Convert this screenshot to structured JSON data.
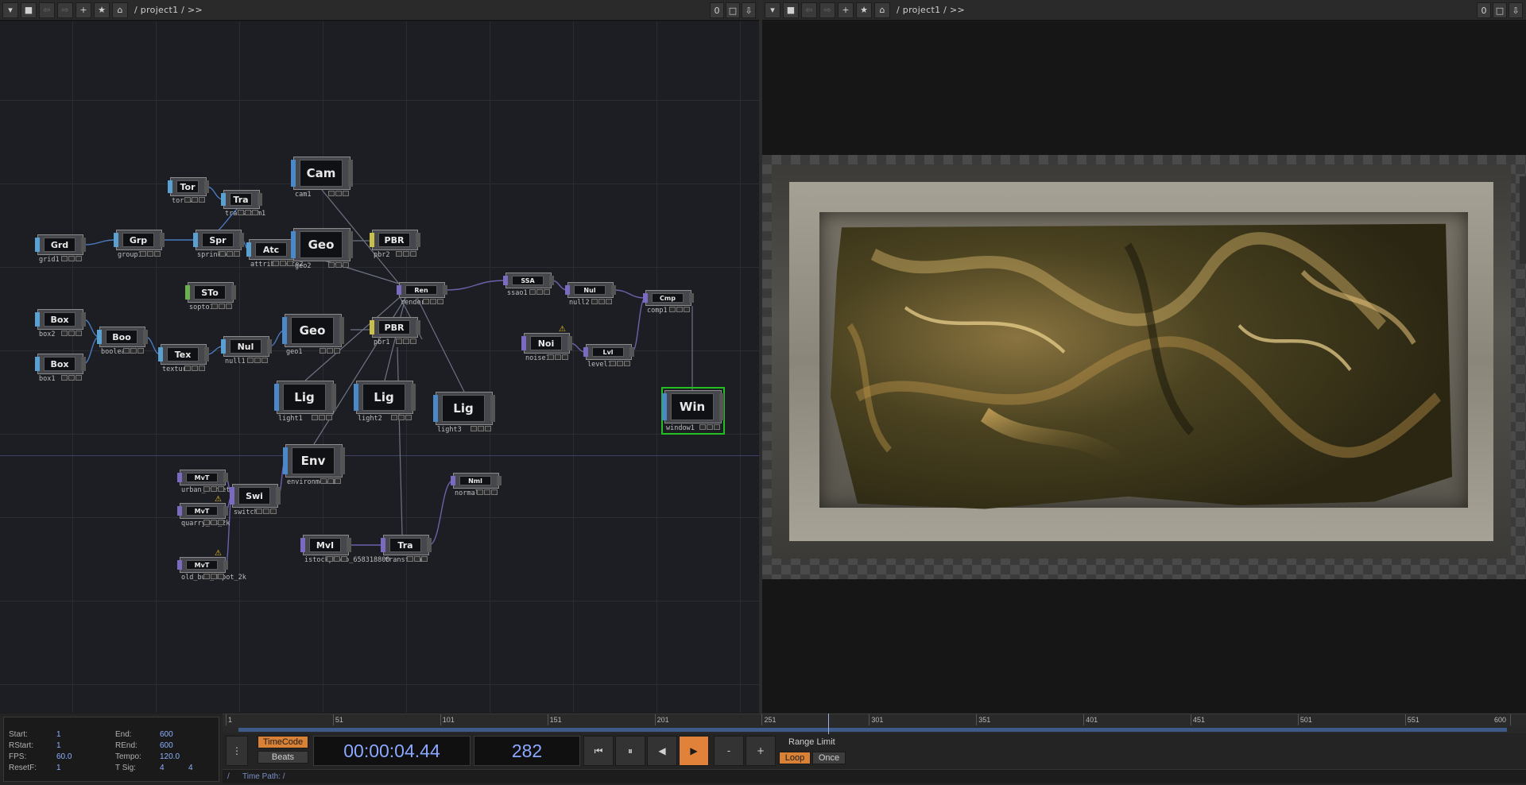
{
  "left_pane": {
    "path": "/ project1 / >>",
    "counter": "0"
  },
  "right_pane": {
    "path": "/ project1 / >>",
    "counter": "0"
  },
  "nodes": [
    {
      "id": "tor",
      "label": "Tor",
      "name": "torus1",
      "family": "sop"
    },
    {
      "id": "tra1",
      "label": "Tra",
      "name": "transform1",
      "family": "sop"
    },
    {
      "id": "cam",
      "label": "Cam",
      "name": "cam1",
      "family": "comp"
    },
    {
      "id": "grd",
      "label": "Grd",
      "name": "grid1",
      "family": "sop"
    },
    {
      "id": "grp",
      "label": "Grp",
      "name": "group1",
      "family": "sop"
    },
    {
      "id": "spr",
      "label": "Spr",
      "name": "sprinkle1",
      "family": "sop"
    },
    {
      "id": "atc",
      "label": "Atc",
      "name": "attribcreate2",
      "family": "sop"
    },
    {
      "id": "geo2",
      "label": "Geo",
      "name": "geo2",
      "family": "comp"
    },
    {
      "id": "pbr2",
      "label": "PBR",
      "name": "pbr2",
      "family": "mat"
    },
    {
      "id": "sto",
      "label": "STo",
      "name": "sopto1",
      "family": "sto"
    },
    {
      "id": "ren",
      "label": "Ren",
      "name": "render1",
      "family": "top"
    },
    {
      "id": "ssa",
      "label": "SSA",
      "name": "ssao1",
      "family": "top"
    },
    {
      "id": "nul2",
      "label": "Nul",
      "name": "null2",
      "family": "top"
    },
    {
      "id": "cmp",
      "label": "Cmp",
      "name": "comp1",
      "family": "top"
    },
    {
      "id": "box2",
      "label": "Box",
      "name": "box2",
      "family": "sop"
    },
    {
      "id": "boo",
      "label": "Boo",
      "name": "boolean3",
      "family": "sop"
    },
    {
      "id": "box1",
      "label": "Box",
      "name": "box1",
      "family": "sop"
    },
    {
      "id": "tex",
      "label": "Tex",
      "name": "texture1",
      "family": "sop"
    },
    {
      "id": "nul1",
      "label": "Nul",
      "name": "null1",
      "family": "sop"
    },
    {
      "id": "geo1",
      "label": "Geo",
      "name": "geo1",
      "family": "comp"
    },
    {
      "id": "pbr1",
      "label": "PBR",
      "name": "pbr1",
      "family": "mat"
    },
    {
      "id": "noi",
      "label": "Noi",
      "name": "noise1",
      "family": "top"
    },
    {
      "id": "lvl",
      "label": "Lvl",
      "name": "level1",
      "family": "top"
    },
    {
      "id": "lig1",
      "label": "Lig",
      "name": "light1",
      "family": "comp"
    },
    {
      "id": "lig2",
      "label": "Lig",
      "name": "light2",
      "family": "comp"
    },
    {
      "id": "lig3",
      "label": "Lig",
      "name": "light3",
      "family": "comp"
    },
    {
      "id": "win",
      "label": "Win",
      "name": "window1",
      "family": "comp"
    },
    {
      "id": "env",
      "label": "Env",
      "name": "environment1",
      "family": "comp"
    },
    {
      "id": "mvt1",
      "label": "MvT",
      "name": "urban_street",
      "family": "top"
    },
    {
      "id": "mvt2",
      "label": "MvT",
      "name": "quarry_03_2k",
      "family": "top"
    },
    {
      "id": "swi",
      "label": "Swi",
      "name": "switch1",
      "family": "top"
    },
    {
      "id": "nml",
      "label": "Nml",
      "name": "normal1",
      "family": "top"
    },
    {
      "id": "mvt3",
      "label": "MvT",
      "name": "old_bus_depot_2k",
      "family": "top"
    },
    {
      "id": "mvi",
      "label": "MvI",
      "name": "istockphoto_658318800",
      "family": "top"
    },
    {
      "id": "tra2",
      "label": "Tra",
      "name": "transform2",
      "family": "top"
    }
  ],
  "timeline": {
    "ticks": [
      "1",
      "51",
      "101",
      "151",
      "201",
      "251",
      "301",
      "351",
      "401",
      "451",
      "501",
      "551",
      "600"
    ],
    "current_frame": 282
  },
  "info": {
    "start_label": "Start:",
    "start": "1",
    "end_label": "End:",
    "end": "600",
    "rstart_label": "RStart:",
    "rstart": "1",
    "rend_label": "REnd:",
    "rend": "600",
    "fps_label": "FPS:",
    "fps": "60.0",
    "tempo_label": "Tempo:",
    "tempo": "120.0",
    "resetf_label": "ResetF:",
    "resetf": "1",
    "tsig_label": "T Sig:",
    "tsig_a": "4",
    "tsig_b": "4"
  },
  "transport": {
    "timecode_label": "TimeCode",
    "beats_label": "Beats",
    "timecode": "00:00:04.44",
    "frame": "282",
    "minus": "-",
    "plus": "+",
    "range_limit_label": "Range Limit",
    "loop_label": "Loop",
    "once_label": "Once"
  },
  "time_path": {
    "slash": "/",
    "label": "Time Path: /"
  },
  "colors": {
    "accent": "#e0823a",
    "sop": "#4a88c8",
    "mat": "#c8c04a",
    "top": "#7a6ac0",
    "selected": "#22c022"
  }
}
